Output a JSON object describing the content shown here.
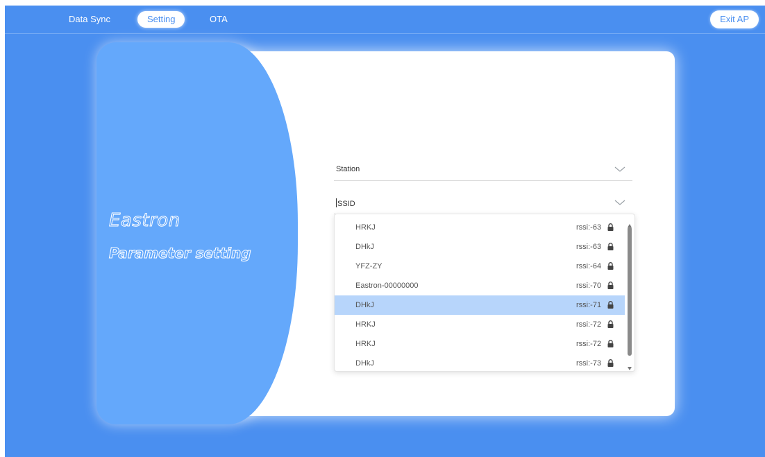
{
  "nav": {
    "tabs": [
      {
        "label": "Data Sync",
        "active": false
      },
      {
        "label": "Setting",
        "active": true
      },
      {
        "label": "OTA",
        "active": false
      }
    ],
    "exit_label": "Exit AP"
  },
  "side_panel": {
    "brand": "Eastron",
    "subtitle": "Parameter setting"
  },
  "form": {
    "mode_select": {
      "value": "Station",
      "icon": "chevron-down-icon"
    },
    "ssid_select": {
      "placeholder": "SSID",
      "icon": "chevron-down-icon"
    }
  },
  "ssid_list": {
    "items": [
      {
        "name": "HRKJ",
        "rssi": "rssi:-63",
        "icon": "lock-icon"
      },
      {
        "name": "DHkJ",
        "rssi": "rssi:-63",
        "icon": "lock-icon"
      },
      {
        "name": "YFZ-ZY",
        "rssi": "rssi:-64",
        "icon": "lock-icon"
      },
      {
        "name": "Eastron-00000000",
        "rssi": "rssi:-70",
        "icon": "lock-icon"
      },
      {
        "name": "DHkJ",
        "rssi": "rssi:-71",
        "icon": "lock-icon",
        "selected": true
      },
      {
        "name": "HRKJ",
        "rssi": "rssi:-72",
        "icon": "lock-icon"
      },
      {
        "name": "HRKJ",
        "rssi": "rssi:-72",
        "icon": "lock-icon"
      },
      {
        "name": "DHkJ",
        "rssi": "rssi:-73",
        "icon": "lock-icon"
      }
    ]
  },
  "colors": {
    "background": "#4a8ff0",
    "side_panel": "#64a8fb",
    "selected_row": "#b7d5fb",
    "card": "#ffffff"
  }
}
